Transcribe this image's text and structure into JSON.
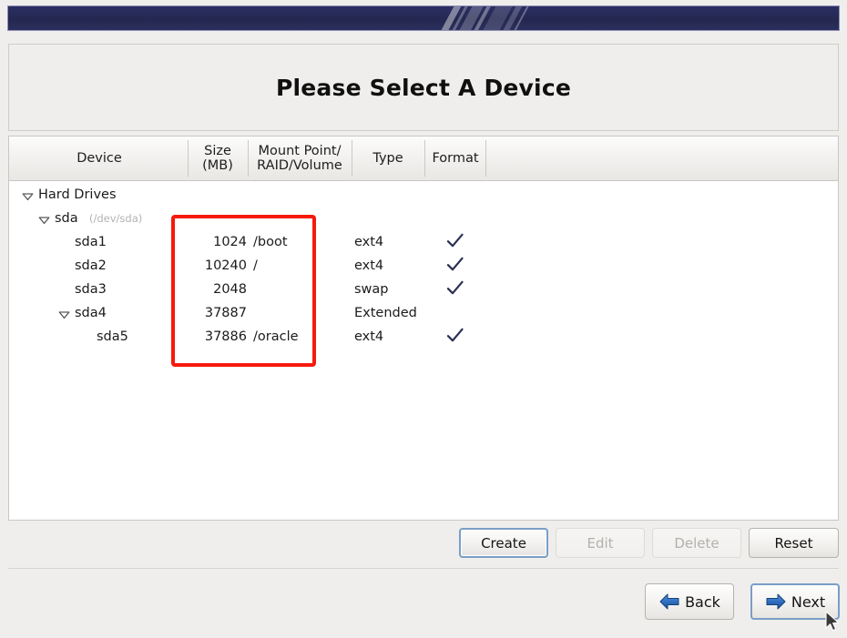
{
  "banner": {
    "name": "decorative-banner"
  },
  "title": {
    "text": "Please Select A Device"
  },
  "table": {
    "columns": [
      {
        "key": "device",
        "label": "Device"
      },
      {
        "key": "size",
        "label": "Size\n(MB)",
        "line1": "Size",
        "line2": "(MB)"
      },
      {
        "key": "mount",
        "label": "Mount Point/\nRAID/Volume",
        "line1": "Mount Point/",
        "line2": "RAID/Volume"
      },
      {
        "key": "type",
        "label": "Type"
      },
      {
        "key": "format",
        "label": "Format"
      }
    ],
    "rows": [
      {
        "device": "Hard Drives",
        "path": "",
        "indent": 0,
        "expander": "expanded",
        "size": "",
        "mount": "",
        "type": "",
        "format": false
      },
      {
        "device": "sda",
        "path": "(/dev/sda)",
        "indent": 1,
        "expander": "expanded",
        "size": "",
        "mount": "",
        "type": "",
        "format": false
      },
      {
        "device": "sda1",
        "path": "",
        "indent": 2,
        "expander": "none",
        "size": "1024",
        "mount": "/boot",
        "type": "ext4",
        "format": true
      },
      {
        "device": "sda2",
        "path": "",
        "indent": 2,
        "expander": "none",
        "size": "10240",
        "mount": "/",
        "type": "ext4",
        "format": true
      },
      {
        "device": "sda3",
        "path": "",
        "indent": 2,
        "expander": "none",
        "size": "2048",
        "mount": "",
        "type": "swap",
        "format": true
      },
      {
        "device": "sda4",
        "path": "",
        "indent": 2,
        "expander": "expanded",
        "size": "37887",
        "mount": "",
        "type": "Extended",
        "format": false
      },
      {
        "device": "sda5",
        "path": "",
        "indent": 3,
        "expander": "none",
        "size": "37886",
        "mount": "/oracle",
        "type": "ext4",
        "format": true
      }
    ]
  },
  "annotation": {
    "name": "red-highlight-rectangle",
    "color": "#f61a0d"
  },
  "actions": {
    "create": {
      "label": "Create",
      "state": "focused"
    },
    "edit": {
      "label": "Edit",
      "state": "disabled"
    },
    "delete": {
      "label": "Delete",
      "state": "disabled"
    },
    "reset": {
      "label": "Reset",
      "state": "normal"
    }
  },
  "nav": {
    "back": {
      "label": "Back",
      "icon": "arrow-left-icon",
      "state": "normal"
    },
    "next": {
      "label": "Next",
      "icon": "arrow-right-icon",
      "state": "focused"
    }
  },
  "colors": {
    "banner": "#262a5e",
    "accent_blue": "#2f6fbf",
    "check": "#2a3055",
    "annotation_red": "#f61a0d",
    "window_bg": "#efeeec"
  },
  "cursor": {
    "name": "mouse-pointer"
  }
}
